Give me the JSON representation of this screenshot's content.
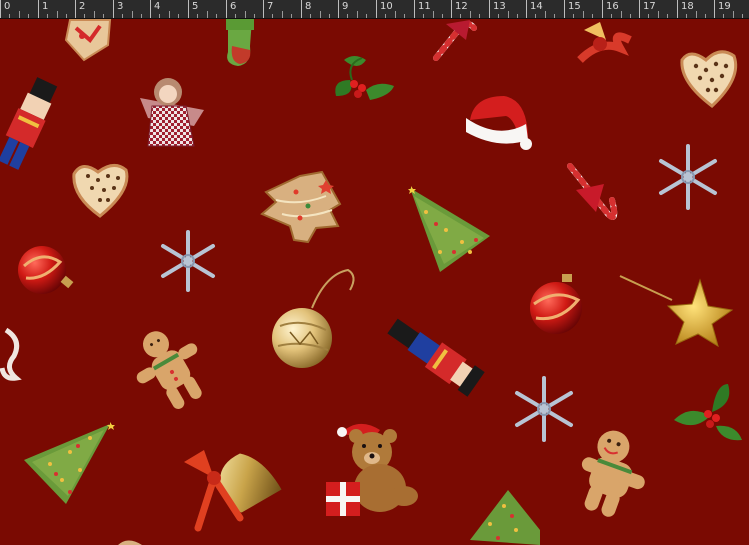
{
  "ruler": {
    "labels": [
      "0",
      "1",
      "2",
      "3",
      "4",
      "5",
      "6",
      "7",
      "8",
      "9",
      "10",
      "11",
      "12",
      "13",
      "14",
      "15",
      "16",
      "17",
      "18",
      "19"
    ]
  },
  "pattern": {
    "background_color": "#7a0a02",
    "motifs": [
      "gingerbread-heart-icon",
      "christmas-stocking-icon",
      "candy-cane-icon",
      "ribbon-bow-icon",
      "nutcracker-icon",
      "angel-doll-icon",
      "holly-icon",
      "santa-hat-icon",
      "christmas-tree-icon",
      "snowflake-icon",
      "tree-cookie-icon",
      "red-bauble-icon",
      "gold-ornament-icon",
      "gingerbread-man-icon",
      "gold-star-icon",
      "teddy-bear-icon",
      "bell-icon"
    ]
  }
}
